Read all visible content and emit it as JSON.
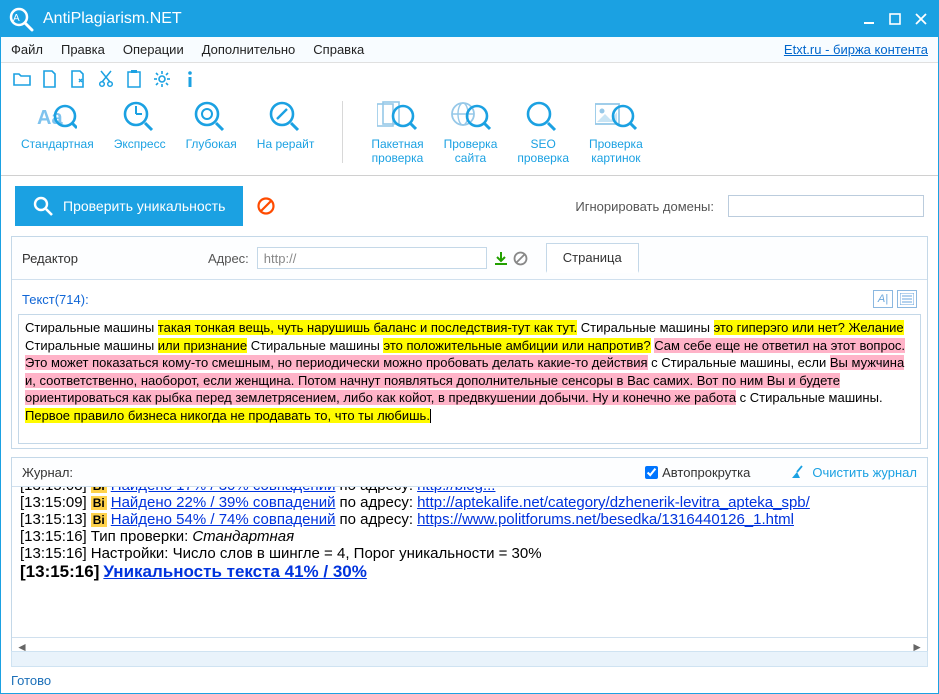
{
  "title": "AntiPlagiarism.NET",
  "menubar": [
    "Файл",
    "Правка",
    "Операции",
    "Дополнительно",
    "Справка"
  ],
  "extlink": "Etxt.ru - биржа контента",
  "ribbon_left": [
    "Стандартная",
    "Экспресс",
    "Глубокая",
    "На рерайт"
  ],
  "ribbon_right": [
    "Пакетная\nпроверка",
    "Проверка\nсайта",
    "SEO\nпроверка",
    "Проверка\nкартинок"
  ],
  "check_btn": "Проверить уникальность",
  "ignore_label": "Игнорировать домены:",
  "ignore_value": "",
  "editor": {
    "title": "Редактор",
    "addr_label": "Адрес:",
    "addr_value": "http://",
    "page_tab": "Страница",
    "text_label": "Текст(714):",
    "segments": [
      {
        "t": "Стиральные машины ",
        "c": ""
      },
      {
        "t": "такая тонкая вещь, чуть нарушишь баланс и последствия-тут как тут.",
        "c": "hlY"
      },
      {
        "t": " Стиральные машины ",
        "c": ""
      },
      {
        "t": "это гиперэго или нет? Желание",
        "c": "hlY"
      },
      {
        "t": " Стиральные машины ",
        "c": ""
      },
      {
        "t": "или признание",
        "c": "hlY"
      },
      {
        "t": " Стиральные машины ",
        "c": ""
      },
      {
        "t": "это положительные амбиции или напротив?",
        "c": "hlY"
      },
      {
        "t": " ",
        "c": ""
      },
      {
        "t": "Сам себе еще не ответил на этот вопрос. Это может показаться кому-то смешным, но периодически можно пробовать делать какие-то действия",
        "c": "hlP"
      },
      {
        "t": " с Стиральные машины, если ",
        "c": ""
      },
      {
        "t": "Вы мужчина и, соответственно, наоборот, если женщина. Потом начнут появляться дополнительные сенсоры в Вас самих. Вот по ним Вы и будете ориентироваться как рыбка перед землетрясением, либо как койот, в предвкушении добычи. Ну и конечно же работа",
        "c": "hlP"
      },
      {
        "t": " с Стиральные машины. ",
        "c": ""
      },
      {
        "t": "Первое правило бизнеса никогда не продавать то, что ты любишь.",
        "c": "hlY"
      }
    ]
  },
  "journal": {
    "title": "Журнал:",
    "autoscroll": "Автопрокрутка",
    "clear": "Очистить журнал",
    "rows": [
      {
        "time": "[13:15:09]",
        "badge": "Bi",
        "link": "Найдено 22% / 39% совпадений",
        "plain": " по адресу: ",
        "url": "http://aptekalife.net/category/dzhenerik-levitra_apteka_spb/"
      },
      {
        "time": "[13:15:13]",
        "badge": "Bi",
        "link": "Найдено 54% / 74% совпадений",
        "plain": " по адресу: ",
        "url": "https://www.politforums.net/besedka/1316440126_1.html"
      },
      {
        "time": "[13:15:16]",
        "plain2": "Тип проверки: ",
        "italic": "Стандартная"
      },
      {
        "time": "[13:15:16]",
        "plain2": "Настройки: Число слов в шингле = 4, Порог уникальности = 30%"
      },
      {
        "time": "[13:15:16]",
        "boldlink": "Уникальность текста 41% / 30%"
      }
    ]
  },
  "status": "Готово"
}
